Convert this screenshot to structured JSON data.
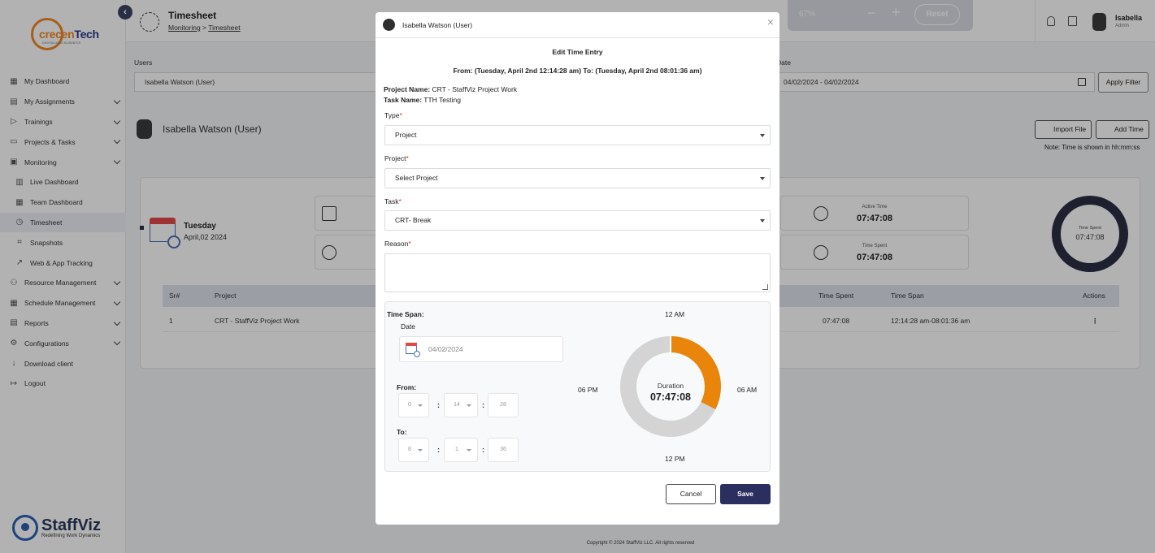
{
  "app": {
    "logo_text_a": "crecen",
    "logo_text_b": "Tech",
    "logo_tagline": "DIGITALIZING BUSINESS",
    "footer_logo_name": "StaffViz",
    "footer_logo_tagline": "Redefining Work Dynamics"
  },
  "sidebar": {
    "items": [
      {
        "label": "My Dashboard",
        "icon": "grid-icon",
        "chevron": false
      },
      {
        "label": "My Assignments",
        "icon": "clipboard-icon",
        "chevron": true
      },
      {
        "label": "Trainings",
        "icon": "play-icon",
        "chevron": true
      },
      {
        "label": "Projects & Tasks",
        "icon": "folder-icon",
        "chevron": true
      },
      {
        "label": "Monitoring",
        "icon": "monitor-icon",
        "chevron": true
      },
      {
        "label": "Live Dashboard",
        "icon": "bar-chart-icon",
        "chevron": false
      },
      {
        "label": "Team Dashboard",
        "icon": "team-grid-icon",
        "chevron": false
      },
      {
        "label": "Timesheet",
        "icon": "clock-icon",
        "chevron": false
      },
      {
        "label": "Snapshots",
        "icon": "crop-icon",
        "chevron": false
      },
      {
        "label": "Web & App Tracking",
        "icon": "trend-icon",
        "chevron": false
      },
      {
        "label": "Resource Management",
        "icon": "people-icon",
        "chevron": true
      },
      {
        "label": "Schedule Management",
        "icon": "calendar-icon",
        "chevron": true
      },
      {
        "label": "Reports",
        "icon": "report-icon",
        "chevron": true
      },
      {
        "label": "Configurations",
        "icon": "gear-icon",
        "chevron": true
      },
      {
        "label": "Download client",
        "icon": "download-icon",
        "chevron": false
      },
      {
        "label": "Logout",
        "icon": "logout-icon",
        "chevron": false
      }
    ]
  },
  "header": {
    "title": "Timesheet",
    "breadcrumb_parent": "Monitoring",
    "breadcrumb_sep": " > ",
    "breadcrumb_current": "Timesheet",
    "zoom_level": "67%",
    "zoom_minus": "−",
    "zoom_plus": "+",
    "zoom_reset": "Reset",
    "user_name": "Isabella",
    "user_role": "Admin"
  },
  "filters": {
    "users_label": "Users",
    "users_value": "Isabella Watson (User)",
    "date_label": "Date",
    "date_value": "04/02/2024 - 04/02/2024",
    "apply_label": "Apply Filter"
  },
  "content": {
    "user_name": "Isabella Watson (User)",
    "import_label": "Import File",
    "add_label": "Add Time",
    "note": "Note: Time is shown in hh:mm:ss",
    "day": "Tuesday",
    "date": "April,02 2024",
    "active_label": "Active Time",
    "active_value": "07:47:08",
    "spent_label": "Time Spent",
    "spent_value": "07:47:08",
    "ring_label": "Time Spent",
    "ring_value": "07:47:08",
    "table_headers": [
      "Sr#",
      "Project",
      "Time Spent",
      "Time Span",
      "Actions"
    ],
    "table_rows": [
      {
        "sr": "1",
        "project": "CRT - StaffViz Project Work",
        "time_spent": "07:47:08",
        "time_span": "12:14:28 am-08:01:36 am",
        "actions": "⋮"
      }
    ],
    "copyright": "Copyright © 2024 StaffViz LLC. All rights reserved"
  },
  "modal": {
    "user": "Isabella Watson (User)",
    "close": "×",
    "title": "Edit Time Entry",
    "range": "From: (Tuesday, April 2nd 12:14:28 am) To: (Tuesday, April 2nd 08:01:36 am)",
    "project_name_label": "Project Name:",
    "project_name_value": " CRT - StaffViz Project Work",
    "task_name_label": "Task Name:",
    "task_name_value": " TTH Testing",
    "type_label": "Type",
    "type_value": "Project",
    "project_label": "Project",
    "project_value": "Select Project",
    "task_label": "Task",
    "task_value": "CRT- Break",
    "reason_label": "Reason",
    "required_mark": "*",
    "time_span_label": "Time Span:",
    "date_label": "Date",
    "date_value": "04/02/2024",
    "from_label": "From:",
    "from_h": "0",
    "from_m": "14",
    "from_s": "28",
    "to_label": "To:",
    "to_h": "8",
    "to_m": "1",
    "to_s": "36",
    "colon": ":",
    "clock_12am": "12 AM",
    "clock_6am": "06 AM",
    "clock_12pm": "12 PM",
    "clock_6pm": "06 PM",
    "duration_label": "Duration",
    "duration_value": "07:47:08",
    "duration_fraction": 0.3245,
    "cancel_label": "Cancel",
    "save_label": "Save",
    "colors": {
      "arc": "#e8850a",
      "track": "#d4d4d4",
      "primary": "#2b2f5f"
    }
  }
}
